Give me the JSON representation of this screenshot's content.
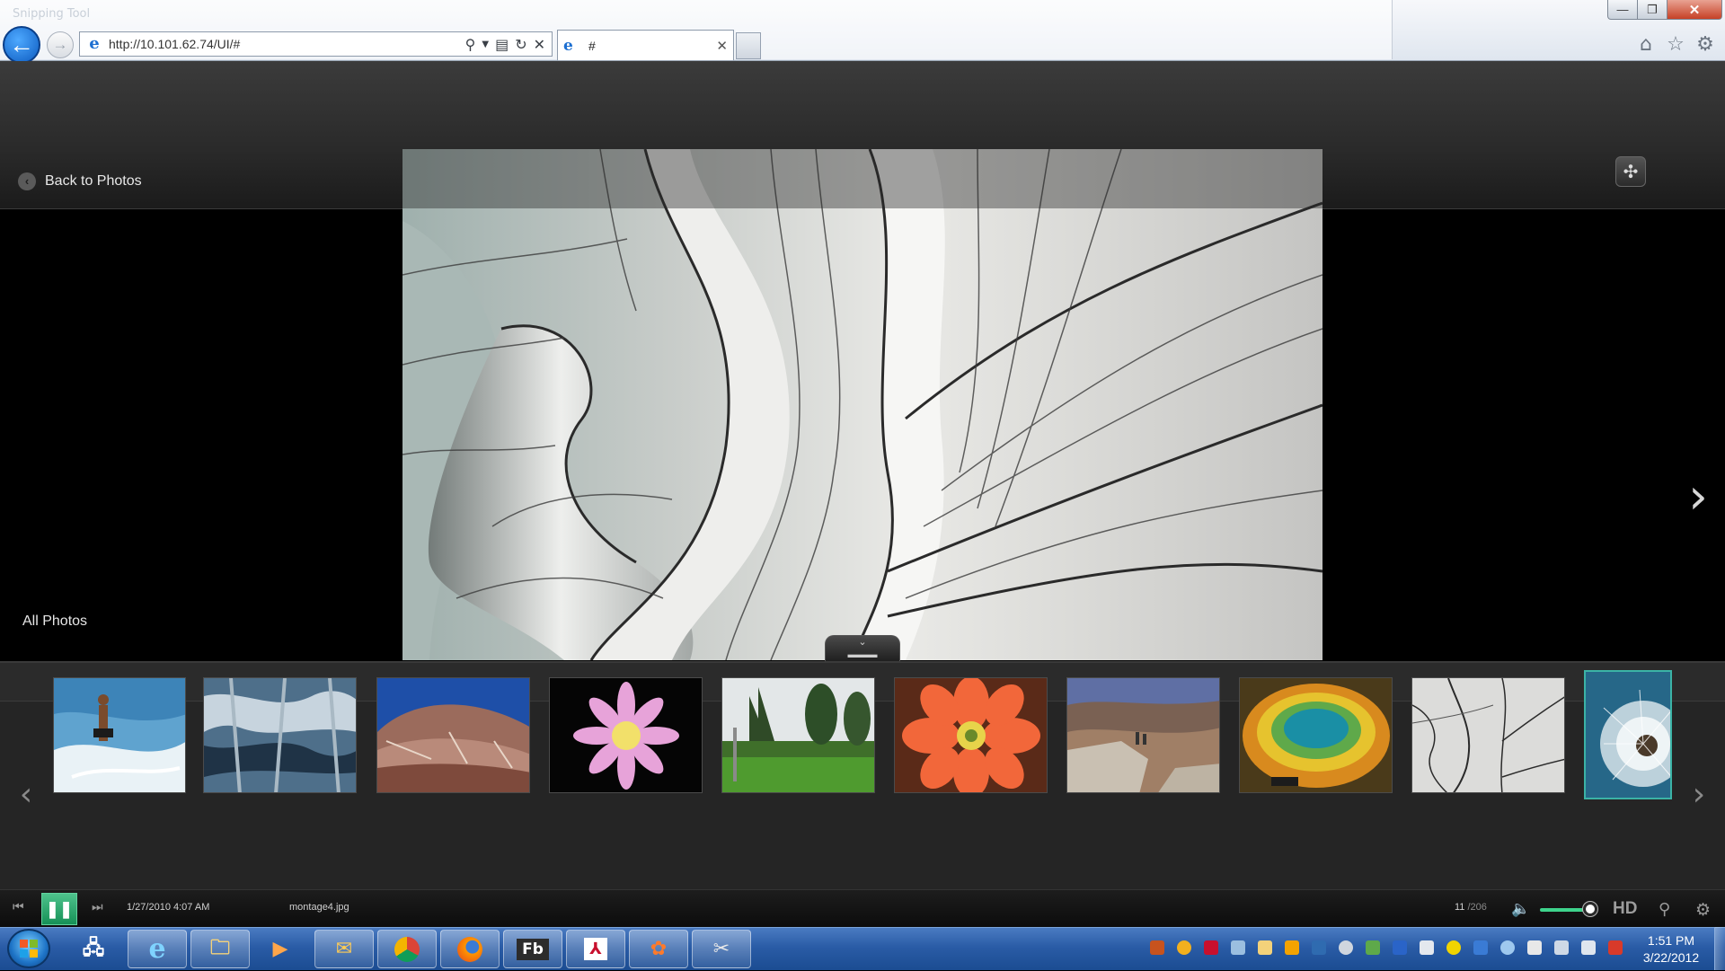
{
  "browser": {
    "ghost_title": "Snipping Tool",
    "address": "http://10.101.62.74/UI/#",
    "tab_title": "#",
    "window_controls": {
      "minimize": "—",
      "maximize": "❐",
      "close": "✕"
    }
  },
  "app": {
    "back_label": "Back to Photos",
    "filmstrip_title": "All Photos",
    "photo_subject": "abstract white architecture",
    "thumbnails": [
      {
        "subject": "surfer"
      },
      {
        "subject": "water reflections"
      },
      {
        "subject": "painted desert hills"
      },
      {
        "subject": "pink cactus flower"
      },
      {
        "subject": "formal garden"
      },
      {
        "subject": "orange cactus flower"
      },
      {
        "subject": "canyon overlook"
      },
      {
        "subject": "hot spring"
      },
      {
        "subject": "abstract white architecture"
      },
      {
        "subject": "dandelion seed head"
      }
    ],
    "selected_thumbnail_index": 9,
    "player": {
      "date": "1/27/2010 4:07 AM",
      "filename": "montage4.jpg",
      "position": "11",
      "total": "/206",
      "hd_label": "HD",
      "volume_level": 0.85
    }
  },
  "taskbar": {
    "apps": [
      "Network",
      "Internet Explorer",
      "Windows Explorer",
      "Media Player",
      "Outlook",
      "Chrome",
      "Firefox",
      "Flash Builder",
      "Adobe Reader",
      "Paint",
      "Snipping Tool"
    ],
    "clock_time": "1:51 PM",
    "clock_date": "3/22/2012"
  },
  "colors": {
    "accent_green": "#1faa65",
    "taskbar_blue": "#2a5ca6",
    "ie_blue": "#1d6fd1"
  }
}
